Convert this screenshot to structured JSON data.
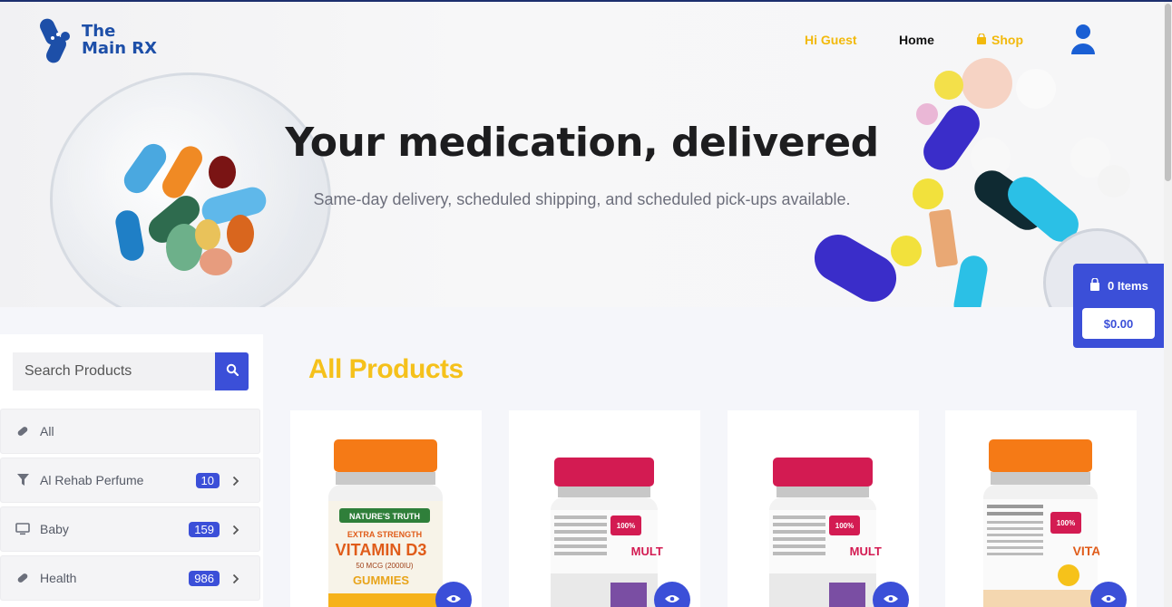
{
  "header": {
    "logo_line1": "The",
    "logo_line2": "Main RX",
    "greeting": "Hi Guest",
    "nav_home": "Home",
    "nav_shop": "Shop"
  },
  "hero": {
    "title": "Your medication, delivered",
    "subtitle": "Same-day delivery, scheduled shipping, and scheduled pick-ups available."
  },
  "cart": {
    "items_label": "0 Items",
    "total": "$0.00"
  },
  "search": {
    "placeholder": "Search Products"
  },
  "categories": [
    {
      "label": "All",
      "icon": "pill-icon"
    },
    {
      "label": "Al Rehab Perfume",
      "count": "10",
      "icon": "filter-icon"
    },
    {
      "label": "Baby",
      "count": "159",
      "icon": "monitor-icon"
    },
    {
      "label": "Health",
      "count": "986",
      "icon": "pill-icon"
    }
  ],
  "products_section": {
    "title": "All Products"
  },
  "product_labels": {
    "p1_brand": "NATURE'S TRUTH",
    "p1_line1": "EXTRA STRENGTH",
    "p1_line2": "VITAMIN D3",
    "p1_line3": "50 MCG (2000IU)",
    "p1_line4": "GUMMIES",
    "p2_badge": "100%",
    "p2_name": "MULTI",
    "p4_badge": "100%",
    "p4_name": "VITA"
  },
  "colors": {
    "accent": "#3b4fd8",
    "highlight": "#f5c11b",
    "logo": "#1d4fa8"
  }
}
